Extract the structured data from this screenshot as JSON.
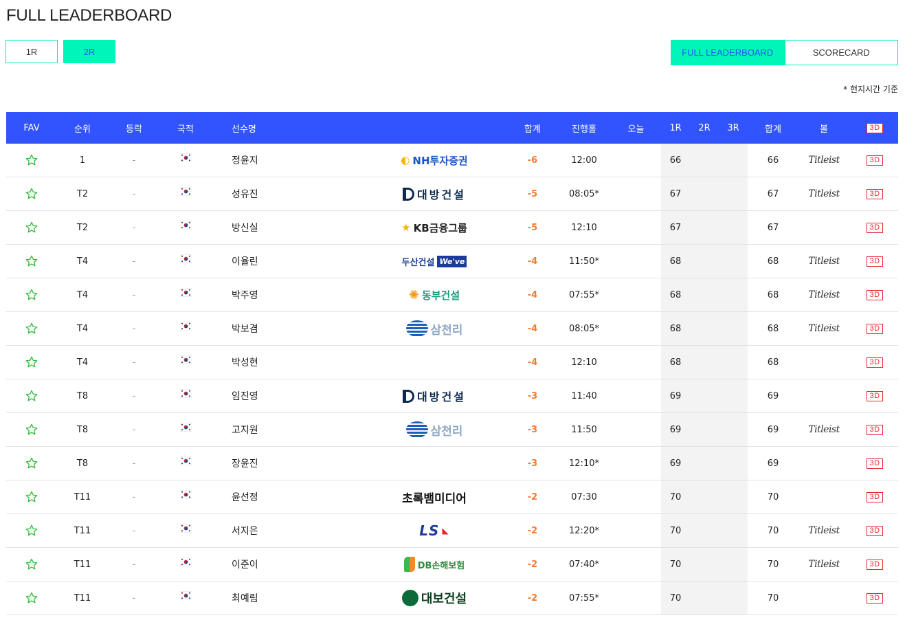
{
  "page": {
    "title": "FULL LEADERBOARD",
    "note": "* 현지시간 기준"
  },
  "round_tabs": [
    {
      "label": "1R",
      "active": false
    },
    {
      "label": "2R",
      "active": true
    }
  ],
  "view_tabs": [
    {
      "label": "FULL LEADERBOARD",
      "active": true
    },
    {
      "label": "SCORECARD",
      "active": false
    }
  ],
  "columns": {
    "fav": "FAV",
    "rank": "순위",
    "move": "등락",
    "nat": "국적",
    "name": "선수명",
    "total": "합계",
    "thru": "진행홀",
    "today": "오늘",
    "r1": "1R",
    "r2": "2R",
    "r3": "3R",
    "sum": "합계",
    "ball": "볼",
    "view3d": "3D"
  },
  "colors": {
    "header_bg": "#3254ff",
    "accent": "#00f5b8",
    "under_par": "#f57a2c",
    "badge_3d": "#e3262d"
  },
  "rows": [
    {
      "rank": "1",
      "move": "-",
      "name": "정윤지",
      "sponsor": "NH투자증권",
      "sponsor_style": "nh",
      "total": "-6",
      "thru": "12:00",
      "r1": "66",
      "sum": "66",
      "ball": "Titleist",
      "view3d": "3D"
    },
    {
      "rank": "T2",
      "move": "-",
      "name": "성유진",
      "sponsor": "대방건설",
      "sponsor_style": "db",
      "total": "-5",
      "thru": "08:05*",
      "r1": "67",
      "sum": "67",
      "ball": "Titleist",
      "view3d": "3D"
    },
    {
      "rank": "T2",
      "move": "-",
      "name": "방신실",
      "sponsor": "KB금융그룹",
      "sponsor_style": "kb",
      "total": "-5",
      "thru": "12:10",
      "r1": "67",
      "sum": "67",
      "ball": "",
      "view3d": "3D"
    },
    {
      "rank": "T4",
      "move": "-",
      "name": "이율린",
      "sponsor": "두산건설",
      "sponsor_style": "doosan",
      "total": "-4",
      "thru": "11:50*",
      "r1": "68",
      "sum": "68",
      "ball": "Titleist",
      "view3d": "3D"
    },
    {
      "rank": "T4",
      "move": "-",
      "name": "박주영",
      "sponsor": "동부건설",
      "sponsor_style": "dongbu",
      "total": "-4",
      "thru": "07:55*",
      "r1": "68",
      "sum": "68",
      "ball": "Titleist",
      "view3d": "3D"
    },
    {
      "rank": "T4",
      "move": "-",
      "name": "박보겸",
      "sponsor": "삼천리",
      "sponsor_style": "samchully",
      "total": "-4",
      "thru": "08:05*",
      "r1": "68",
      "sum": "68",
      "ball": "Titleist",
      "view3d": "3D"
    },
    {
      "rank": "T4",
      "move": "-",
      "name": "박성현",
      "sponsor": "",
      "sponsor_style": "",
      "total": "-4",
      "thru": "12:10",
      "r1": "68",
      "sum": "68",
      "ball": "",
      "view3d": "3D"
    },
    {
      "rank": "T8",
      "move": "-",
      "name": "임진영",
      "sponsor": "대방건설",
      "sponsor_style": "db",
      "total": "-3",
      "thru": "11:40",
      "r1": "69",
      "sum": "69",
      "ball": "",
      "view3d": "3D"
    },
    {
      "rank": "T8",
      "move": "-",
      "name": "고지원",
      "sponsor": "삼천리",
      "sponsor_style": "samchully",
      "total": "-3",
      "thru": "11:50",
      "r1": "69",
      "sum": "69",
      "ball": "Titleist",
      "view3d": "3D"
    },
    {
      "rank": "T8",
      "move": "-",
      "name": "장윤진",
      "sponsor": "",
      "sponsor_style": "",
      "total": "-3",
      "thru": "12:10*",
      "r1": "69",
      "sum": "69",
      "ball": "",
      "view3d": "3D"
    },
    {
      "rank": "T11",
      "move": "-",
      "name": "윤선정",
      "sponsor": "초록뱀미디어",
      "sponsor_style": "chorok",
      "total": "-2",
      "thru": "07:30",
      "r1": "70",
      "sum": "70",
      "ball": "",
      "view3d": "3D"
    },
    {
      "rank": "T11",
      "move": "-",
      "name": "서지은",
      "sponsor": "LS",
      "sponsor_style": "ls",
      "total": "-2",
      "thru": "12:20*",
      "r1": "70",
      "sum": "70",
      "ball": "Titleist",
      "view3d": "3D"
    },
    {
      "rank": "T11",
      "move": "-",
      "name": "이준이",
      "sponsor": "DB손해보험",
      "sponsor_style": "dbins",
      "total": "-2",
      "thru": "07:40*",
      "r1": "70",
      "sum": "70",
      "ball": "Titleist",
      "view3d": "3D"
    },
    {
      "rank": "T11",
      "move": "-",
      "name": "최예림",
      "sponsor": "대보건설",
      "sponsor_style": "daebo",
      "total": "-2",
      "thru": "07:55*",
      "r1": "70",
      "sum": "70",
      "ball": "",
      "view3d": "3D"
    }
  ]
}
